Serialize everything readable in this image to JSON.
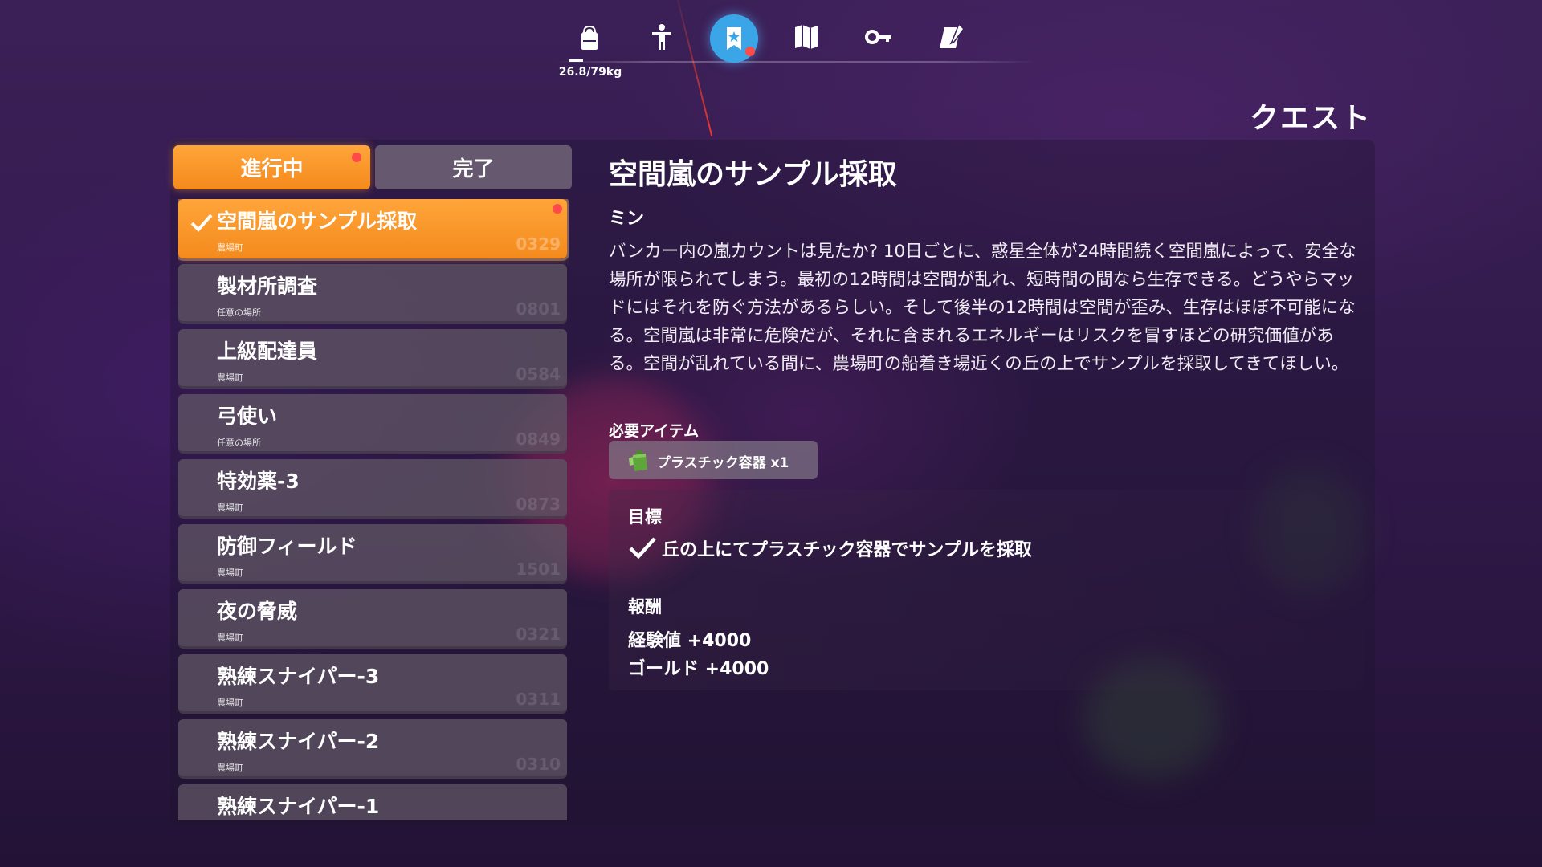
{
  "nav": {
    "weight": "26.8/79kg",
    "icons": [
      "backpack-icon",
      "character-icon",
      "quest-icon",
      "map-icon",
      "key-icon",
      "journal-icon"
    ],
    "active": "quest-icon"
  },
  "page_title": "クエスト",
  "tabs": {
    "in_progress": "進行中",
    "completed": "完了"
  },
  "quests": [
    {
      "name": "空間嵐のサンプル採取",
      "location": "農場町",
      "number": "0329",
      "selected": true,
      "done": true,
      "new": true
    },
    {
      "name": "製材所調査",
      "location": "任意の場所",
      "number": "0801"
    },
    {
      "name": "上級配達員",
      "location": "農場町",
      "number": "0584"
    },
    {
      "name": "弓使い",
      "location": "任意の場所",
      "number": "0849"
    },
    {
      "name": "特効薬-3",
      "location": "農場町",
      "number": "0873"
    },
    {
      "name": "防御フィールド",
      "location": "農場町",
      "number": "1501"
    },
    {
      "name": "夜の脅威",
      "location": "農場町",
      "number": "0321"
    },
    {
      "name": "熟練スナイパー-3",
      "location": "農場町",
      "number": "0311"
    },
    {
      "name": "熟練スナイパー-2",
      "location": "農場町",
      "number": "0310"
    },
    {
      "name": "熟練スナイパー-1",
      "location": "",
      "number": ""
    }
  ],
  "detail": {
    "title": "空間嵐のサンプル採取",
    "giver": "ミン",
    "description": "バンカー内の嵐カウントは見たか? 10日ごとに、惑星全体が24時間続く空間嵐によって、安全な場所が限られてしまう。最初の12時間は空間が乱れ、短時間の間なら生存できる。どうやらマッドにはそれを防ぐ方法があるらしい。そして後半の12時間は空間が歪み、生存はほぼ不可能になる。空間嵐は非常に危険だが、それに含まれるエネルギーはリスクを冒すほどの研究価値がある。空間が乱れている間に、農場町の船着き場近くの丘の上でサンプルを採取してきてほしい。",
    "required_label": "必要アイテム",
    "required_item": "プラスチック容器 x1",
    "goal_label": "目標",
    "goal": "丘の上にてプラスチック容器でサンプルを採取",
    "reward_label": "報酬",
    "rewards": [
      "経験値 +4000",
      "ゴールド +4000"
    ]
  },
  "colors": {
    "accent_orange": "#f7931f",
    "active_icon_blue": "#3aa6e8",
    "notify_red": "#ff4a4a"
  }
}
